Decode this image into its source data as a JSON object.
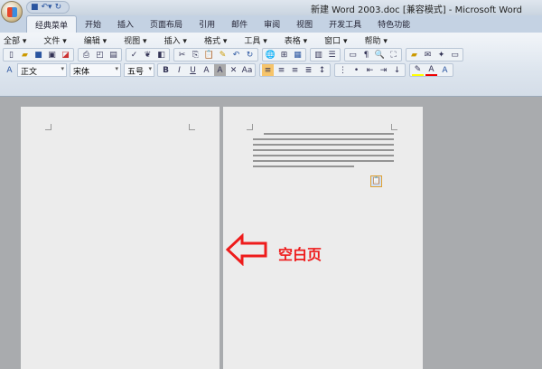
{
  "title": "新建 Word 2003.doc [兼容模式] - Microsoft Word",
  "tabs": [
    "经典菜单",
    "开始",
    "插入",
    "页面布局",
    "引用",
    "邮件",
    "审阅",
    "视图",
    "开发工具",
    "特色功能"
  ],
  "menu": [
    "全部 ▾",
    "文件 ▾",
    "编辑 ▾",
    "视图 ▾",
    "插入 ▾",
    "格式 ▾",
    "工具 ▾",
    "表格 ▾",
    "窗口 ▾",
    "帮助 ▾"
  ],
  "format_bar": {
    "style": "正文",
    "font": "宋体",
    "size": "五号"
  },
  "annotation": {
    "text": "空白页",
    "color": "#ee1c1c"
  }
}
